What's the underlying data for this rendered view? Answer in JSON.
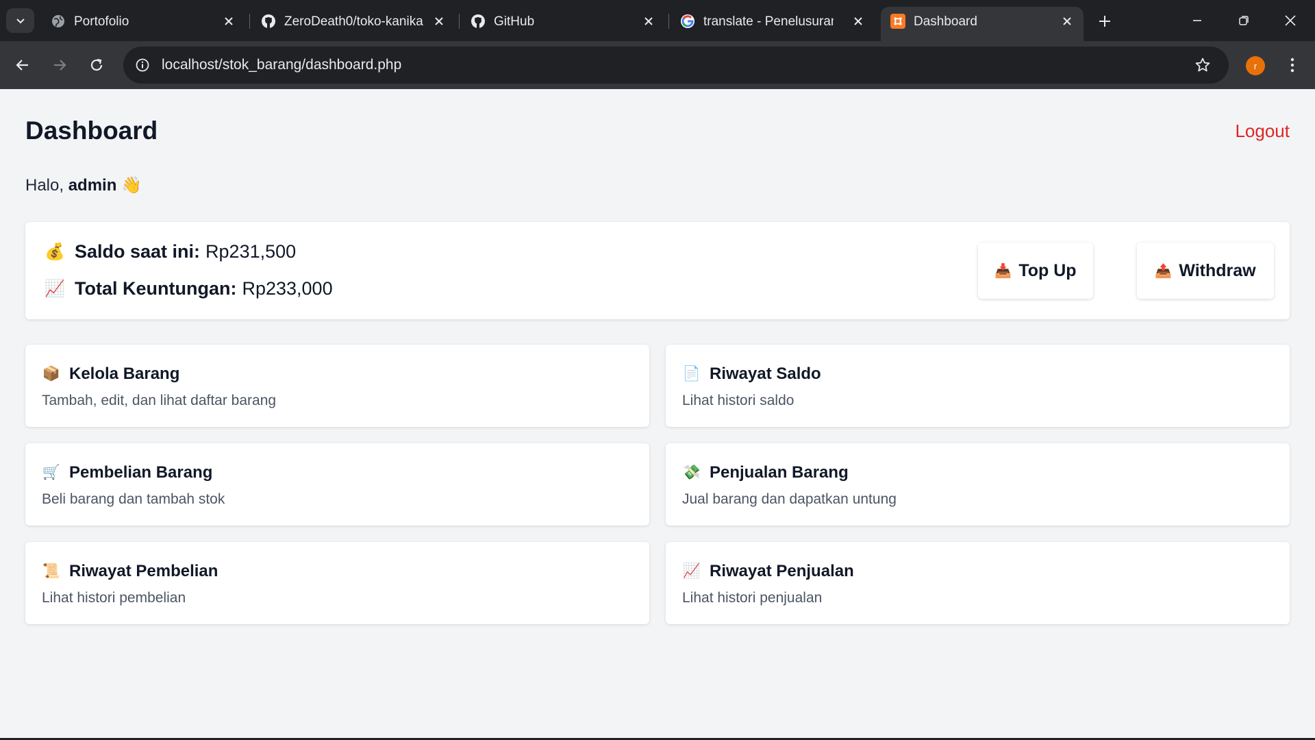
{
  "browser": {
    "tabs": [
      {
        "title": "Portofolio",
        "icon": "globe-icon"
      },
      {
        "title": "ZeroDeath0/toko-kanika",
        "icon": "github-icon"
      },
      {
        "title": "GitHub",
        "icon": "github-icon"
      },
      {
        "title": "translate - Penelusuran Google",
        "icon": "google-icon"
      },
      {
        "title": "Dashboard",
        "icon": "xampp-icon",
        "active": true
      }
    ],
    "url": "localhost/stok_barang/dashboard.php",
    "profile_initial": "r",
    "colors": {
      "tabbar": "#202124",
      "toolbar": "#35363a",
      "profile": "#e8710a"
    }
  },
  "page": {
    "title": "Dashboard",
    "logout_label": "Logout",
    "greeting_prefix": "Halo, ",
    "username": "admin",
    "greeting_emoji": "👋",
    "balance": {
      "saldo_emoji": "💰",
      "saldo_label": "Saldo saat ini:",
      "saldo_value": "Rp231,500",
      "profit_emoji": "📈",
      "profit_label": "Total Keuntungan:",
      "profit_value": "Rp233,000"
    },
    "actions": {
      "topup_emoji": "📥",
      "topup_label": "Top Up",
      "withdraw_emoji": "📤",
      "withdraw_label": "Withdraw"
    },
    "menu": [
      {
        "emoji": "📦",
        "title": "Kelola Barang",
        "desc": "Tambah, edit, dan lihat daftar barang"
      },
      {
        "emoji": "📄",
        "title": "Riwayat Saldo",
        "desc": "Lihat histori saldo"
      },
      {
        "emoji": "🛒",
        "title": "Pembelian Barang",
        "desc": "Beli barang dan tambah stok"
      },
      {
        "emoji": "💸",
        "title": "Penjualan Barang",
        "desc": "Jual barang dan dapatkan untung"
      },
      {
        "emoji": "📜",
        "title": "Riwayat Pembelian",
        "desc": "Lihat histori pembelian"
      },
      {
        "emoji": "📈",
        "title": "Riwayat Penjualan",
        "desc": "Lihat histori penjualan"
      }
    ],
    "colors": {
      "background": "#f3f4f6",
      "card": "#ffffff",
      "logout": "#dc2626",
      "muted_text": "#4b5563"
    }
  }
}
